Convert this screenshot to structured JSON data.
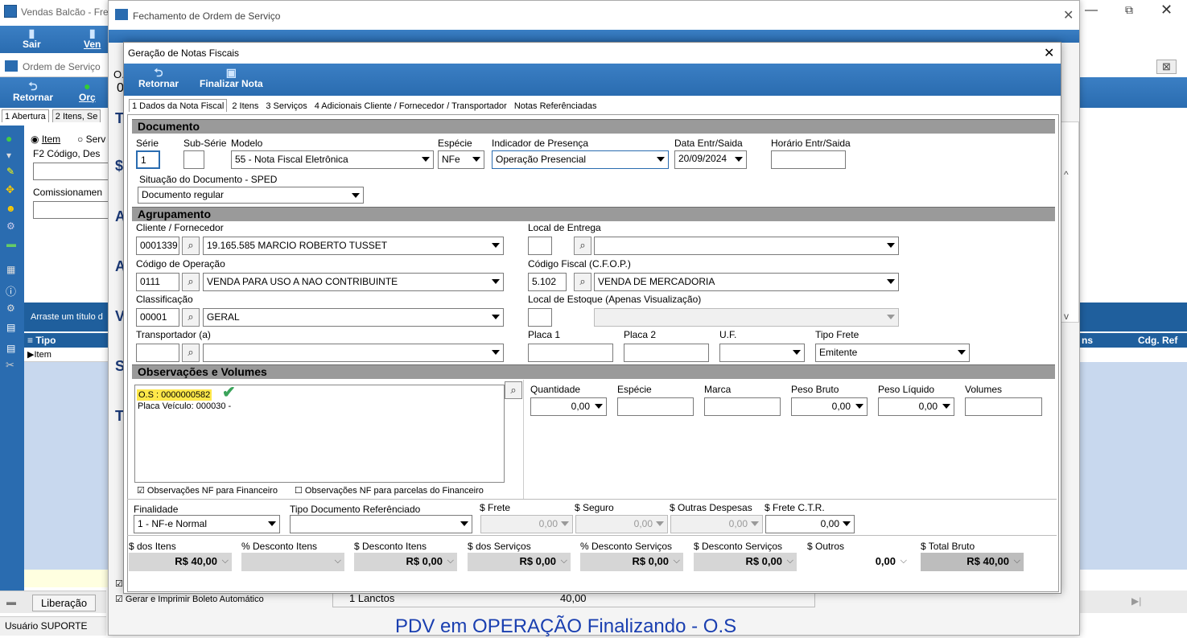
{
  "bg_win": {
    "title": "Vendas Balcão - Fre",
    "btn_sair": "Sair",
    "btn_vend": "Ven",
    "os_title": "Ordem de Serviço",
    "btn_retornar": "Retornar",
    "btn_orc": "Orç",
    "tab1": "1 Abertura",
    "tab2": "2 Itens, Se",
    "radio_item": "Item",
    "radio_serv": "Serv",
    "lbl_codigo": "F2 Código, Des",
    "lbl_comiss": "Comissionamen",
    "drag_hint": "Arraste um título d",
    "grid_tipo": "Tipo",
    "grid_item": "Item",
    "liberacao": "Liberação",
    "usuario": "Usuário SUPORTE",
    "right_col1": "ns",
    "right_col2": "Cdg. Ref",
    "close_glyph": "⊠"
  },
  "fech_win": {
    "title": "Fechamento de Ordem de Serviço",
    "o_label": "O.",
    "zero": "0",
    "letters": [
      "T",
      "$",
      "A",
      "A",
      "V",
      "S",
      "T"
    ],
    "lancto": "1 Lanctos",
    "lancto_val": "40,00",
    "gerar_boleto": "Gerar e Imprimir Boleto Automático",
    "pdv_msg": "PDV em OPERAÇÃO Finalizando - O.S"
  },
  "dialog": {
    "title": "Geração de Notas Fiscais",
    "btn_retornar": "Retornar",
    "btn_finalizar": "Finalizar Nota",
    "tabs": [
      "1 Dados da Nota Fiscal",
      "2 Itens",
      "3 Serviços",
      "4 Adicionais Cliente / Fornecedor / Transportador",
      "Notas Referênciadas"
    ],
    "sec_documento": "Documento",
    "lbl_serie": "Série",
    "val_serie": "1",
    "lbl_subserie": "Sub-Série",
    "val_subserie": "",
    "lbl_modelo": "Modelo",
    "val_modelo": "55 - Nota Fiscal Eletrônica",
    "lbl_especie": "Espécie",
    "val_especie": "NFe",
    "lbl_indicador": "Indicador de Presença",
    "val_indicador": "Operação Presencial",
    "lbl_data": "Data Entr/Saida",
    "val_data": "20/09/2024",
    "lbl_horario": "Horário Entr/Saida",
    "val_horario": "",
    "lbl_situacao": "Situação do Documento - SPED",
    "val_situacao": "Documento regular",
    "sec_agrup": "Agrupamento",
    "lbl_cliente": "Cliente / Fornecedor",
    "val_cliente_cod": "0001339",
    "val_cliente_nome": "19.165.585 MARCIO ROBERTO TUSSET",
    "lbl_local_entrega": "Local de Entrega",
    "lbl_cod_op": "Código de Operação",
    "val_cod_op": "0111",
    "val_cod_op_nome": "VENDA PARA USO A NAO CONTRIBUINTE",
    "lbl_cfop": "Código Fiscal (C.F.O.P.)",
    "val_cfop": "5.102",
    "val_cfop_nome": "VENDA DE MERCADORIA",
    "lbl_classif": "Classificação",
    "val_classif": "00001",
    "val_classif_nome": "GERAL",
    "lbl_local_estoque": "Local de Estoque (Apenas Visualização)",
    "lbl_transp": "Transportador (a)",
    "lbl_placa1": "Placa 1",
    "lbl_placa2": "Placa 2",
    "lbl_uf": "U.F.",
    "lbl_tipo_frete": "Tipo Frete",
    "val_tipo_frete": "Emitente",
    "sec_obs": "Observações e Volumes",
    "obs_line1": "O.S : 0000000582",
    "obs_line2": "Placa Veículo: 000030 -",
    "lbl_quantidade": "Quantidade",
    "val_quantidade": "0,00",
    "lbl_especie_vol": "Espécie",
    "lbl_marca": "Marca",
    "lbl_peso_bruto": "Peso Bruto",
    "val_peso_bruto": "0,00",
    "lbl_peso_liq": "Peso Líquido",
    "val_peso_liq": "0,00",
    "lbl_volumes": "Volumes",
    "chk_obs_fin": "Observações NF para Financeiro",
    "chk_obs_parc": "Observações NF para parcelas do Financeiro",
    "lbl_finalidade": "Finalidade",
    "val_finalidade": "1 - NF-e Normal",
    "lbl_tipo_doc": "Tipo Documento Referênciado",
    "lbl_frete": "$ Frete",
    "val_frete": "0,00",
    "lbl_seguro": "$ Seguro",
    "val_seguro": "0,00",
    "lbl_outras": "$ Outras Despesas",
    "val_outras": "0,00",
    "lbl_frete_ctr": "$ Frete C.T.R.",
    "val_frete_ctr": "0,00",
    "lbl_dos_itens": "$ dos Itens",
    "val_dos_itens": "R$ 40,00",
    "lbl_pct_desc_itens": "% Desconto Itens",
    "lbl_desc_itens": "$ Desconto Itens",
    "val_desc_itens": "R$ 0,00",
    "lbl_dos_serv": "$ dos Serviços",
    "val_dos_serv": "R$ 0,00",
    "lbl_pct_desc_serv": "% Desconto Serviços",
    "val_pct_desc_serv": "R$ 0,00",
    "lbl_desc_serv": "$ Desconto Serviços",
    "val_desc_serv": "R$ 0,00",
    "lbl_outros": "$ Outros",
    "val_outros": "0,00",
    "lbl_total_bruto": "$ Total Bruto",
    "val_total_bruto": "R$ 40,00"
  }
}
